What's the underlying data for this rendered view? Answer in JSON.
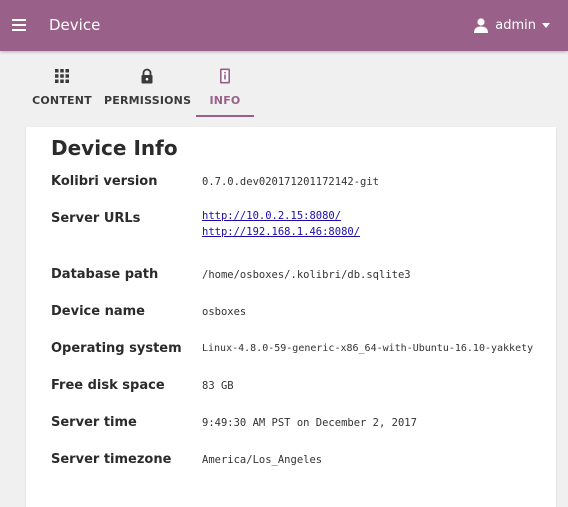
{
  "appbar": {
    "title": "Device",
    "username": "admin",
    "bg_color": "#996189",
    "menu_icon": "hamburger-menu-icon",
    "user_icon": "person-icon"
  },
  "tabs": [
    {
      "label": "CONTENT",
      "icon": "grid-icon",
      "active": false
    },
    {
      "label": "PERMISSIONS",
      "icon": "lock-icon",
      "active": false
    },
    {
      "label": "INFO",
      "icon": "device-info-icon",
      "active": true
    }
  ],
  "info": {
    "heading": "Device Info",
    "kolibri_version": {
      "label": "Kolibri version",
      "value": "0.7.0.dev020171201172142-git"
    },
    "server_urls": {
      "label": "Server URLs",
      "urls": [
        "http://10.0.2.15:8080/",
        "http://192.168.1.46:8080/"
      ]
    },
    "database_path": {
      "label": "Database path",
      "value": "/home/osboxes/.kolibri/db.sqlite3"
    },
    "device_name": {
      "label": "Device name",
      "value": "osboxes"
    },
    "operating_system": {
      "label": "Operating system",
      "value": "Linux-4.8.0-59-generic-x86_64-with-Ubuntu-16.10-yakkety"
    },
    "free_disk_space": {
      "label": "Free disk space",
      "value": "83 GB"
    },
    "server_time": {
      "label": "Server time",
      "value": "9:49:30 AM PST on December 2, 2017"
    },
    "server_timezone": {
      "label": "Server timezone",
      "value": "America/Los_Angeles"
    }
  },
  "colors": {
    "accent": "#996189",
    "link": "#1a0dab",
    "background": "#f0f0f0"
  }
}
